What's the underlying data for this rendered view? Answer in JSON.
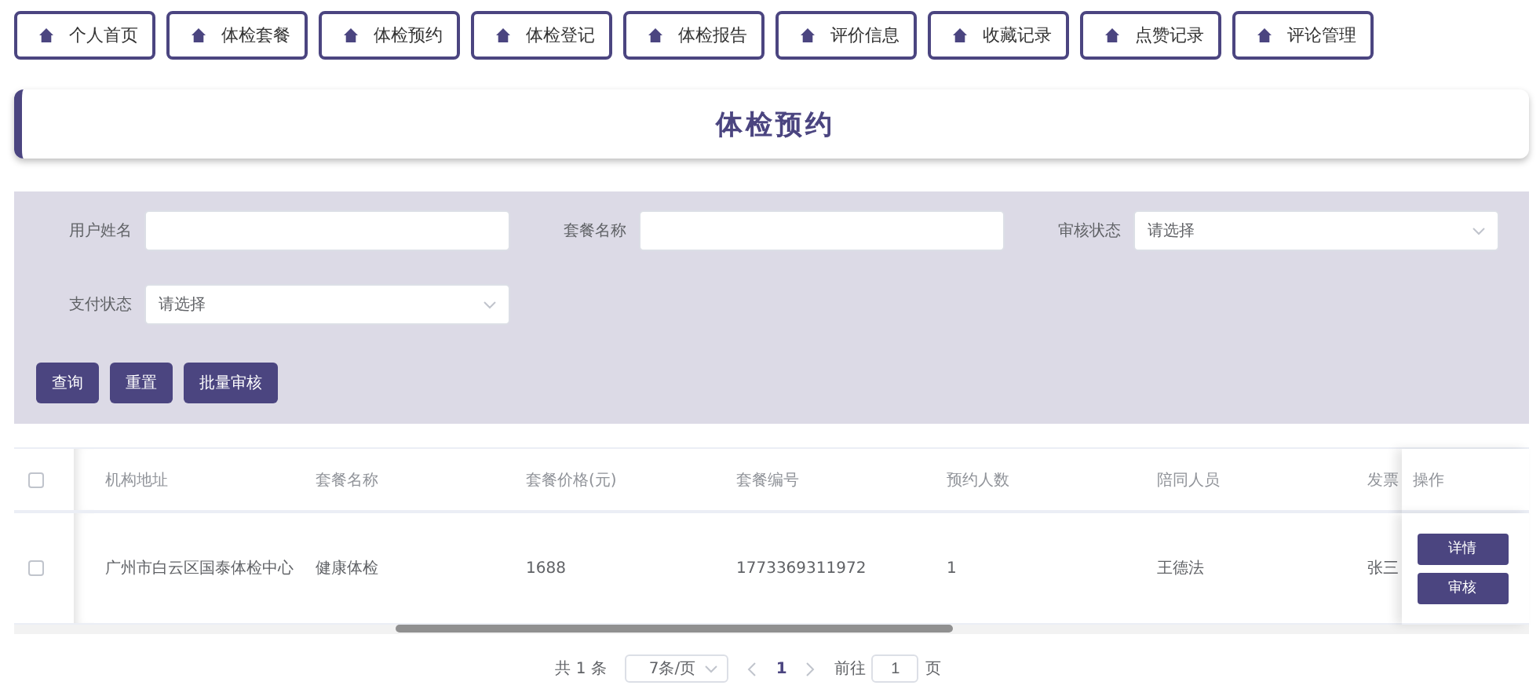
{
  "nav": [
    {
      "label": "个人首页",
      "selected": false
    },
    {
      "label": "体检套餐",
      "selected": false
    },
    {
      "label": "体检预约",
      "selected": false
    },
    {
      "label": "体检登记",
      "selected": false
    },
    {
      "label": "体检报告",
      "selected": false
    },
    {
      "label": "评价信息",
      "selected": false
    },
    {
      "label": "收藏记录",
      "selected": false
    },
    {
      "label": "点赞记录",
      "selected": false
    },
    {
      "label": "评论管理",
      "selected": false
    }
  ],
  "title": "体检预约",
  "filters": [
    {
      "kind": "text",
      "label": "用户姓名"
    },
    {
      "kind": "text",
      "label": "套餐名称"
    },
    {
      "kind": "select",
      "label": "审核状态",
      "placeholder": "请选择"
    },
    {
      "kind": "select",
      "label": "支付状态",
      "placeholder": "请选择"
    }
  ],
  "buttons": [
    "查询",
    "重置",
    "批量审核"
  ],
  "table": {
    "all_checked": false,
    "columns": [
      "机构地址",
      "套餐名称",
      "套餐价格(元)",
      "套餐编号",
      "预约人数",
      "陪同人员",
      "发票"
    ],
    "action_column": "操作",
    "rows": [
      {
        "checked": false,
        "cells": [
          "广州市白云区国泰体检中心",
          "健康体检",
          "1688",
          "1773369311972",
          "1",
          "王德法",
          "张三"
        ],
        "actions": [
          "详情",
          "审核"
        ]
      }
    ]
  },
  "pagination": {
    "total": "共 1 条",
    "page_size": "7条/页",
    "pages": [
      {
        "label": "1",
        "selected": true
      }
    ],
    "goto_label": "前往",
    "goto_value": "1",
    "goto_suffix": "页"
  }
}
